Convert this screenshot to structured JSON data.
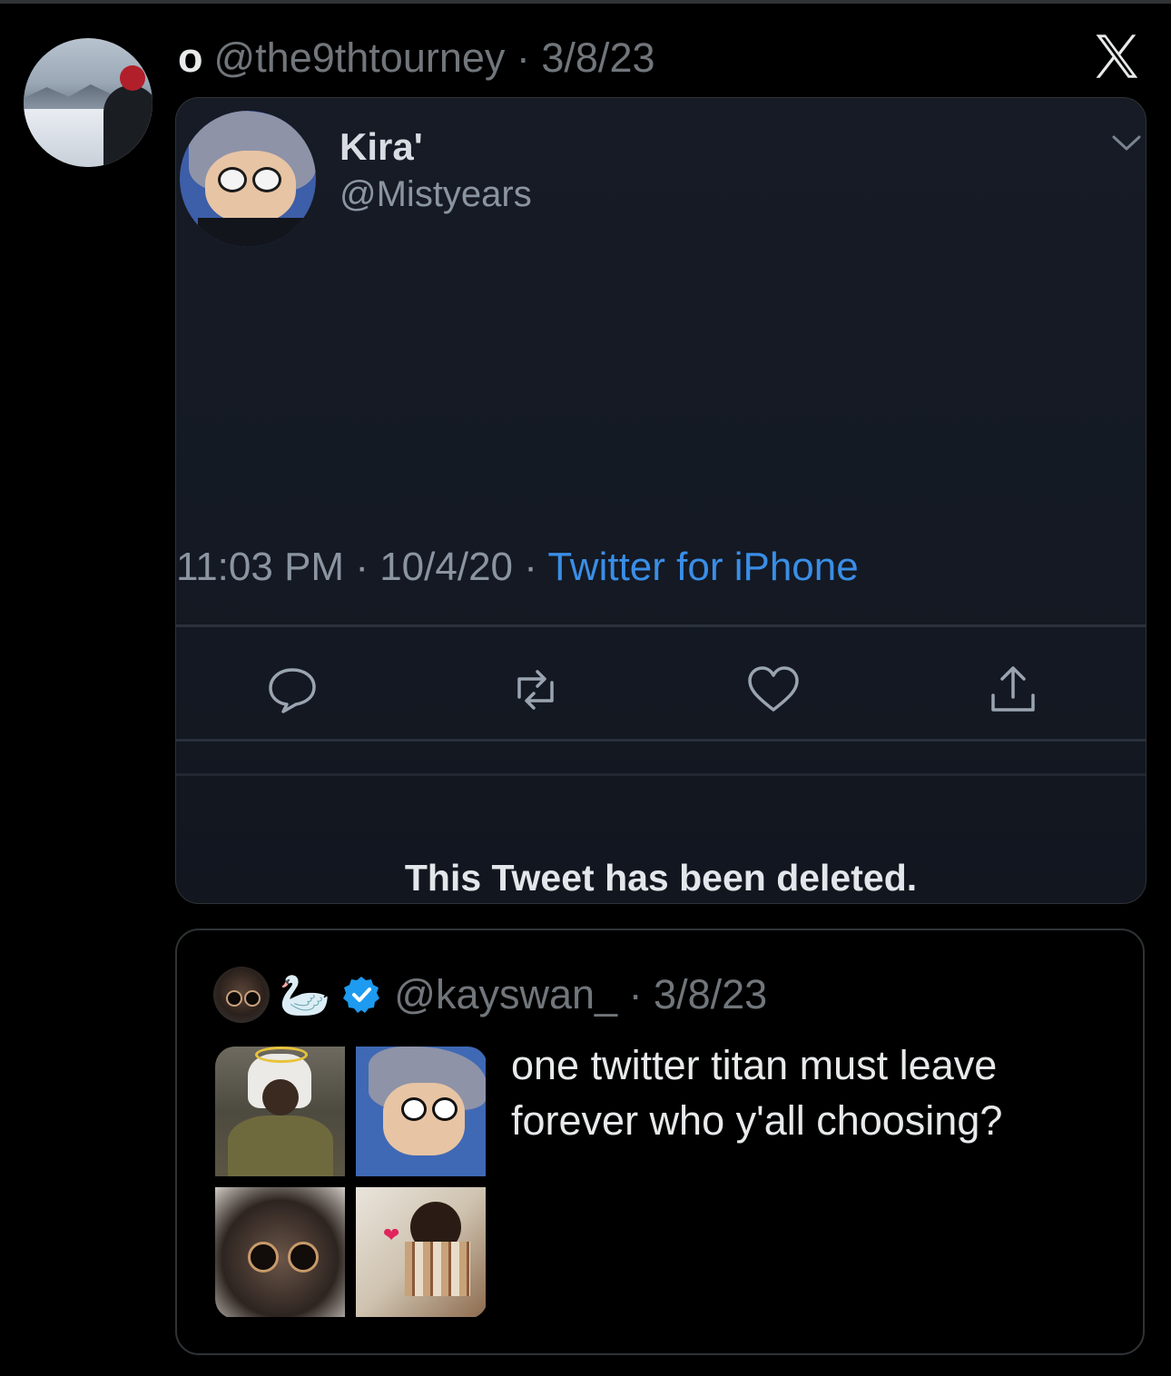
{
  "tweet": {
    "display_name": "o",
    "handle_date": "@the9thtourney · 3/8/23",
    "platform_logo": "x-logo"
  },
  "screenshot": {
    "name": "Kira'",
    "handle": "@Mistyears",
    "time": "11:03 PM",
    "date": "10/4/20",
    "source": "Twitter for iPhone",
    "actions": [
      "reply-icon",
      "retweet-icon",
      "like-icon",
      "share-icon"
    ],
    "deleted_notice": "This Tweet has been deleted."
  },
  "quote": {
    "emoji": "🦢",
    "handle_date": "@kayswan_ · 3/8/23",
    "verified": true,
    "text": "one twitter titan must leave forever who y'all choosing?"
  },
  "colors": {
    "background": "#000000",
    "border": "#2f3336",
    "muted_text": "#71767b",
    "primary_text": "#e7e9ea",
    "link_blue": "#3a8ee6",
    "verified_blue": "#1d9bf0"
  }
}
